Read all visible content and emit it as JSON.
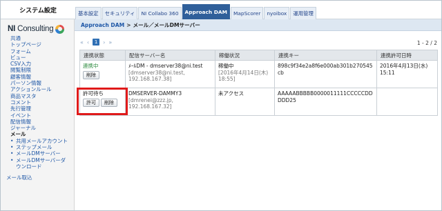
{
  "app": {
    "title": "システム設定"
  },
  "tabs": [
    {
      "label": "基本設定",
      "active": false
    },
    {
      "label": "セキュリティ",
      "active": false
    },
    {
      "label": "NI Collabo 360",
      "active": false
    },
    {
      "label": "Approach DAM",
      "active": true
    },
    {
      "label": "MapScorer",
      "active": false
    },
    {
      "label": "nyoibox",
      "active": false
    },
    {
      "label": "運用管理",
      "active": false
    }
  ],
  "logo": {
    "brand_bold": "NI",
    "brand_rest": " Consulting"
  },
  "sidebar": {
    "items": [
      "共通",
      "トップページ",
      "フォーム",
      "ビュー",
      "CSV入力",
      "閲覧制限",
      "顧客情報",
      "パーソン情報",
      "アクションルール",
      "商品マスタ",
      "コメント",
      "先行管理",
      "イベント",
      "配信情報",
      "ジャーナル"
    ],
    "mail_heading": "メール",
    "mail_subitems": [
      "共用メールアカウント",
      "ステップメール",
      "メールDMサーバー",
      "メールDMサーバーダウンロード"
    ],
    "last_item": "メール取込"
  },
  "breadcrumb": {
    "root": "Approach DAM",
    "separator": ">",
    "current": "メール／メールDMサーバー"
  },
  "pager": {
    "first": "«",
    "prev": "‹",
    "current": "1",
    "next": "›",
    "last": "»",
    "count": "1 - 2 / 2"
  },
  "table": {
    "headers": [
      "連携状態",
      "配信サーバー名",
      "稼働状況",
      "連携キー",
      "連携許可日時"
    ],
    "rows": [
      {
        "status": "連携中",
        "buttons": [
          "削除"
        ],
        "server_name": "ﾒｰﾙDM - dmserver38@ni.test",
        "server_sub": "[dmserver38@ni.test, 192.168.167.38]",
        "op_status": "稼働中",
        "op_sub": "[2016年4月14日(木) 18:55]",
        "key": "898c9f34e2a8f6e000ab301b270545cb",
        "allowed_at": "2016年4月13日(水) 15:11"
      },
      {
        "status": "許可待ち",
        "buttons": [
          "許可",
          "削除"
        ],
        "server_name": "DMSERVER-DAMMY3",
        "server_sub": "[dmrenei@zzz.jp, 192.168.167.32]",
        "op_status": "未アクセス",
        "op_sub": "",
        "key": "AAAAABBBBB0000011111CCCCCDDDDD25",
        "allowed_at": ""
      }
    ]
  },
  "colors": {
    "accent": "#2f5f9a",
    "highlight": "#e01a1a",
    "link": "#1d56a6",
    "status_ok": "#2b8a3e"
  }
}
